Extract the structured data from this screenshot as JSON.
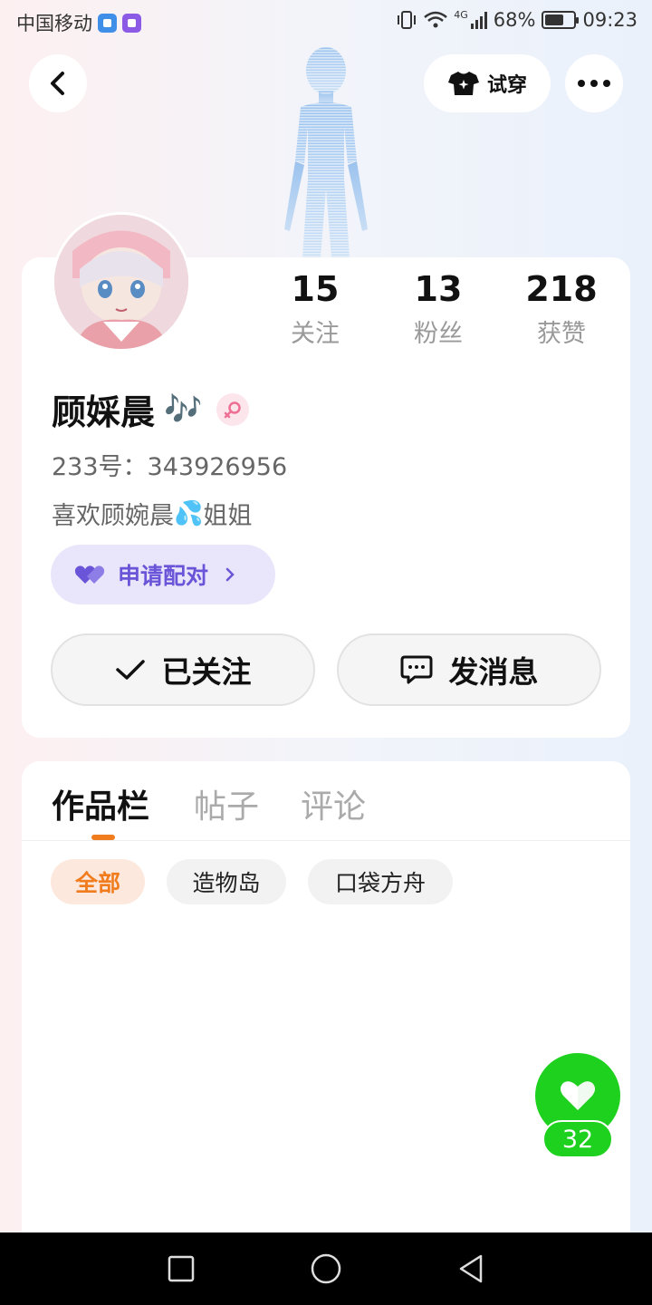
{
  "status_bar": {
    "carrier": "中国移动",
    "network": "4G",
    "battery": "68%",
    "battery_level": 0.68,
    "time": "09:23"
  },
  "header": {
    "back_icon": "chevron-left-icon",
    "try_on_label": "试穿",
    "try_on_icon": "tshirt-icon",
    "more_icon": "more-dots-icon"
  },
  "profile": {
    "stats": [
      {
        "value": "15",
        "label": "关注"
      },
      {
        "value": "13",
        "label": "粉丝"
      },
      {
        "value": "218",
        "label": "获赞"
      }
    ],
    "nickname": "顾婇晨",
    "nickname_emoji": "🎶",
    "gender_icon": "female-icon",
    "user_id": "233号：343926956",
    "bio_before": "喜欢顾婉晨",
    "bio_emoji": "💦",
    "bio_after": "姐姐",
    "pair_label": "申请配对",
    "follow_label": "已关注",
    "message_label": "发消息"
  },
  "works": {
    "tabs": [
      "作品栏",
      "帖子",
      "评论"
    ],
    "active_tab": 0,
    "filters": [
      "全部",
      "造物岛",
      "口袋方舟"
    ],
    "active_filter": 0
  },
  "like_fab": {
    "count": "32"
  },
  "colors": {
    "accent_orange": "#f07c1d",
    "pair_purple": "#6a55d8",
    "like_green": "#1fd11f"
  }
}
